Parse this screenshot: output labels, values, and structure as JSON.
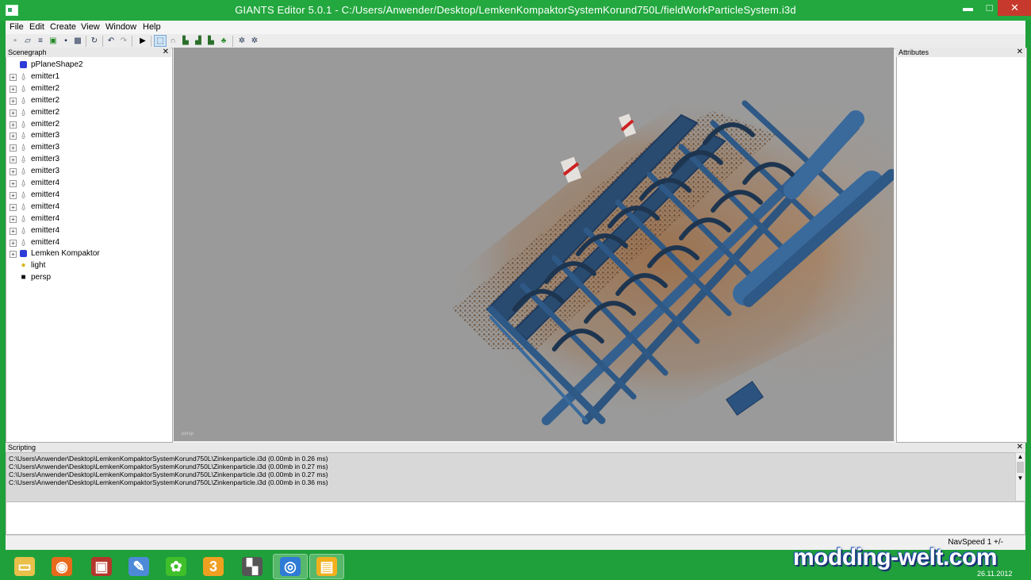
{
  "window": {
    "title": "GIANTS Editor 5.0.1 - C:/Users/Anwender/Desktop/LemkenKompaktorSystemKorund750L/fieldWorkParticleSystem.i3d",
    "minimize_glyph": "▬",
    "maximize_glyph": "□",
    "close_glyph": "✕"
  },
  "menu": {
    "items": [
      "File",
      "Edit",
      "Create",
      "View",
      "Window",
      "Help"
    ]
  },
  "toolbar": {
    "icons": [
      "new-file-icon",
      "open-file-icon",
      "open-recent-icon",
      "import-icon",
      "save-icon",
      "save-as-icon",
      "reload-icon",
      "undo-icon",
      "redo-icon",
      "play-icon",
      "select-tool-icon",
      "magnet-icon",
      "terrain-icon",
      "terrain-paint-icon",
      "terrain-foliage-icon",
      "foliage-icon",
      "settings-icon",
      "settings-alt-icon"
    ]
  },
  "scenegraph": {
    "title": "Scenegraph",
    "close": "✕",
    "nodes": [
      {
        "label": "pPlaneShape2",
        "icon": "shape-icon",
        "expandable": false
      },
      {
        "label": "emitter1",
        "icon": "emitter-icon",
        "expandable": true
      },
      {
        "label": "emitter2",
        "icon": "emitter-icon",
        "expandable": true
      },
      {
        "label": "emitter2",
        "icon": "emitter-icon",
        "expandable": true
      },
      {
        "label": "emitter2",
        "icon": "emitter-icon",
        "expandable": true
      },
      {
        "label": "emitter2",
        "icon": "emitter-icon",
        "expandable": true
      },
      {
        "label": "emitter3",
        "icon": "emitter-icon",
        "expandable": true
      },
      {
        "label": "emitter3",
        "icon": "emitter-icon",
        "expandable": true
      },
      {
        "label": "emitter3",
        "icon": "emitter-icon",
        "expandable": true
      },
      {
        "label": "emitter3",
        "icon": "emitter-icon",
        "expandable": true
      },
      {
        "label": "emitter4",
        "icon": "emitter-icon",
        "expandable": true
      },
      {
        "label": "emitter4",
        "icon": "emitter-icon",
        "expandable": true
      },
      {
        "label": "emitter4",
        "icon": "emitter-icon",
        "expandable": true
      },
      {
        "label": "emitter4",
        "icon": "emitter-icon",
        "expandable": true
      },
      {
        "label": "emitter4",
        "icon": "emitter-icon",
        "expandable": true
      },
      {
        "label": "emitter4",
        "icon": "emitter-icon",
        "expandable": true
      },
      {
        "label": "Lemken Kompaktor",
        "icon": "shape-icon",
        "expandable": true
      },
      {
        "label": "light",
        "icon": "light-icon",
        "expandable": false
      },
      {
        "label": "persp",
        "icon": "camera-icon",
        "expandable": false
      }
    ]
  },
  "viewport": {
    "camera_label": "persp"
  },
  "attributes": {
    "title": "Attributes",
    "close": "✕"
  },
  "scripting": {
    "title": "Scripting",
    "close": "✕",
    "log_lines": [
      "C:\\Users\\Anwender\\Desktop\\LemkenKompaktorSystemKorund750L\\Zinkenparticle.i3d (0.00mb in 0.26 ms)",
      "C:\\Users\\Anwender\\Desktop\\LemkenKompaktorSystemKorund750L\\Zinkenparticle.i3d (0.00mb in 0.27 ms)",
      "C:\\Users\\Anwender\\Desktop\\LemkenKompaktorSystemKorund750L\\Zinkenparticle.i3d (0.00mb in 0.27 ms)",
      "C:\\Users\\Anwender\\Desktop\\LemkenKompaktorSystemKorund750L\\Zinkenparticle.i3d (0.00mb in 0.36 ms)"
    ]
  },
  "status": {
    "navspeed": "NavSpeed 1 +/-"
  },
  "taskbar": {
    "apps": [
      {
        "name": "file-explorer-icon",
        "glyph": "▭",
        "color": "#e8c04a",
        "active": false
      },
      {
        "name": "firefox-icon",
        "glyph": "◉",
        "color": "#e86a1c",
        "active": false
      },
      {
        "name": "farming-simulator-icon",
        "glyph": "▣",
        "color": "#b4372c",
        "active": false
      },
      {
        "name": "paint-icon",
        "glyph": "✎",
        "color": "#4c8ad8",
        "active": false
      },
      {
        "name": "icq-icon",
        "glyph": "✿",
        "color": "#3fbf2a",
        "active": false
      },
      {
        "name": "number-three-app-icon",
        "glyph": "3",
        "color": "#f0a020",
        "active": false
      },
      {
        "name": "truck-app-icon",
        "glyph": "▚",
        "color": "#555555",
        "active": false
      },
      {
        "name": "globe-app-icon",
        "glyph": "◎",
        "color": "#2f7bd6",
        "active": true
      },
      {
        "name": "giants-editor-icon",
        "glyph": "▤",
        "color": "#f2b01e",
        "active": true
      }
    ],
    "watermark": "modding-welt.com",
    "date": "26.11.2012"
  }
}
